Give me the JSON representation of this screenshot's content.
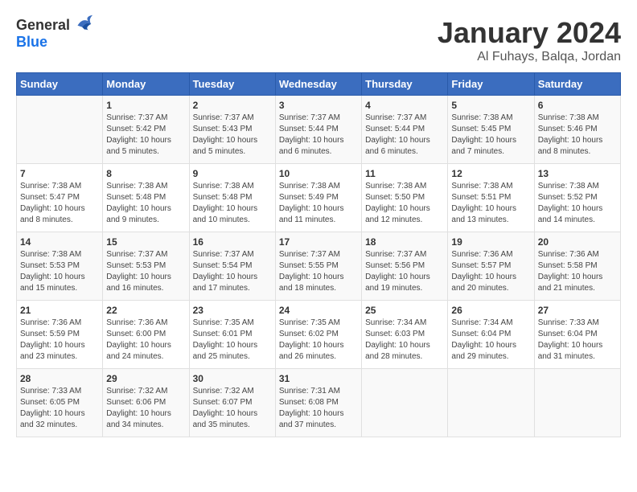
{
  "logo": {
    "general": "General",
    "blue": "Blue"
  },
  "title": "January 2024",
  "location": "Al Fuhays, Balqa, Jordan",
  "days_of_week": [
    "Sunday",
    "Monday",
    "Tuesday",
    "Wednesday",
    "Thursday",
    "Friday",
    "Saturday"
  ],
  "weeks": [
    [
      {
        "day": "",
        "sunrise": "",
        "sunset": "",
        "daylight": ""
      },
      {
        "day": "1",
        "sunrise": "Sunrise: 7:37 AM",
        "sunset": "Sunset: 5:42 PM",
        "daylight": "Daylight: 10 hours and 5 minutes."
      },
      {
        "day": "2",
        "sunrise": "Sunrise: 7:37 AM",
        "sunset": "Sunset: 5:43 PM",
        "daylight": "Daylight: 10 hours and 5 minutes."
      },
      {
        "day": "3",
        "sunrise": "Sunrise: 7:37 AM",
        "sunset": "Sunset: 5:44 PM",
        "daylight": "Daylight: 10 hours and 6 minutes."
      },
      {
        "day": "4",
        "sunrise": "Sunrise: 7:37 AM",
        "sunset": "Sunset: 5:44 PM",
        "daylight": "Daylight: 10 hours and 6 minutes."
      },
      {
        "day": "5",
        "sunrise": "Sunrise: 7:38 AM",
        "sunset": "Sunset: 5:45 PM",
        "daylight": "Daylight: 10 hours and 7 minutes."
      },
      {
        "day": "6",
        "sunrise": "Sunrise: 7:38 AM",
        "sunset": "Sunset: 5:46 PM",
        "daylight": "Daylight: 10 hours and 8 minutes."
      }
    ],
    [
      {
        "day": "7",
        "sunrise": "Sunrise: 7:38 AM",
        "sunset": "Sunset: 5:47 PM",
        "daylight": "Daylight: 10 hours and 8 minutes."
      },
      {
        "day": "8",
        "sunrise": "Sunrise: 7:38 AM",
        "sunset": "Sunset: 5:48 PM",
        "daylight": "Daylight: 10 hours and 9 minutes."
      },
      {
        "day": "9",
        "sunrise": "Sunrise: 7:38 AM",
        "sunset": "Sunset: 5:48 PM",
        "daylight": "Daylight: 10 hours and 10 minutes."
      },
      {
        "day": "10",
        "sunrise": "Sunrise: 7:38 AM",
        "sunset": "Sunset: 5:49 PM",
        "daylight": "Daylight: 10 hours and 11 minutes."
      },
      {
        "day": "11",
        "sunrise": "Sunrise: 7:38 AM",
        "sunset": "Sunset: 5:50 PM",
        "daylight": "Daylight: 10 hours and 12 minutes."
      },
      {
        "day": "12",
        "sunrise": "Sunrise: 7:38 AM",
        "sunset": "Sunset: 5:51 PM",
        "daylight": "Daylight: 10 hours and 13 minutes."
      },
      {
        "day": "13",
        "sunrise": "Sunrise: 7:38 AM",
        "sunset": "Sunset: 5:52 PM",
        "daylight": "Daylight: 10 hours and 14 minutes."
      }
    ],
    [
      {
        "day": "14",
        "sunrise": "Sunrise: 7:38 AM",
        "sunset": "Sunset: 5:53 PM",
        "daylight": "Daylight: 10 hours and 15 minutes."
      },
      {
        "day": "15",
        "sunrise": "Sunrise: 7:37 AM",
        "sunset": "Sunset: 5:53 PM",
        "daylight": "Daylight: 10 hours and 16 minutes."
      },
      {
        "day": "16",
        "sunrise": "Sunrise: 7:37 AM",
        "sunset": "Sunset: 5:54 PM",
        "daylight": "Daylight: 10 hours and 17 minutes."
      },
      {
        "day": "17",
        "sunrise": "Sunrise: 7:37 AM",
        "sunset": "Sunset: 5:55 PM",
        "daylight": "Daylight: 10 hours and 18 minutes."
      },
      {
        "day": "18",
        "sunrise": "Sunrise: 7:37 AM",
        "sunset": "Sunset: 5:56 PM",
        "daylight": "Daylight: 10 hours and 19 minutes."
      },
      {
        "day": "19",
        "sunrise": "Sunrise: 7:36 AM",
        "sunset": "Sunset: 5:57 PM",
        "daylight": "Daylight: 10 hours and 20 minutes."
      },
      {
        "day": "20",
        "sunrise": "Sunrise: 7:36 AM",
        "sunset": "Sunset: 5:58 PM",
        "daylight": "Daylight: 10 hours and 21 minutes."
      }
    ],
    [
      {
        "day": "21",
        "sunrise": "Sunrise: 7:36 AM",
        "sunset": "Sunset: 5:59 PM",
        "daylight": "Daylight: 10 hours and 23 minutes."
      },
      {
        "day": "22",
        "sunrise": "Sunrise: 7:36 AM",
        "sunset": "Sunset: 6:00 PM",
        "daylight": "Daylight: 10 hours and 24 minutes."
      },
      {
        "day": "23",
        "sunrise": "Sunrise: 7:35 AM",
        "sunset": "Sunset: 6:01 PM",
        "daylight": "Daylight: 10 hours and 25 minutes."
      },
      {
        "day": "24",
        "sunrise": "Sunrise: 7:35 AM",
        "sunset": "Sunset: 6:02 PM",
        "daylight": "Daylight: 10 hours and 26 minutes."
      },
      {
        "day": "25",
        "sunrise": "Sunrise: 7:34 AM",
        "sunset": "Sunset: 6:03 PM",
        "daylight": "Daylight: 10 hours and 28 minutes."
      },
      {
        "day": "26",
        "sunrise": "Sunrise: 7:34 AM",
        "sunset": "Sunset: 6:04 PM",
        "daylight": "Daylight: 10 hours and 29 minutes."
      },
      {
        "day": "27",
        "sunrise": "Sunrise: 7:33 AM",
        "sunset": "Sunset: 6:04 PM",
        "daylight": "Daylight: 10 hours and 31 minutes."
      }
    ],
    [
      {
        "day": "28",
        "sunrise": "Sunrise: 7:33 AM",
        "sunset": "Sunset: 6:05 PM",
        "daylight": "Daylight: 10 hours and 32 minutes."
      },
      {
        "day": "29",
        "sunrise": "Sunrise: 7:32 AM",
        "sunset": "Sunset: 6:06 PM",
        "daylight": "Daylight: 10 hours and 34 minutes."
      },
      {
        "day": "30",
        "sunrise": "Sunrise: 7:32 AM",
        "sunset": "Sunset: 6:07 PM",
        "daylight": "Daylight: 10 hours and 35 minutes."
      },
      {
        "day": "31",
        "sunrise": "Sunrise: 7:31 AM",
        "sunset": "Sunset: 6:08 PM",
        "daylight": "Daylight: 10 hours and 37 minutes."
      },
      {
        "day": "",
        "sunrise": "",
        "sunset": "",
        "daylight": ""
      },
      {
        "day": "",
        "sunrise": "",
        "sunset": "",
        "daylight": ""
      },
      {
        "day": "",
        "sunrise": "",
        "sunset": "",
        "daylight": ""
      }
    ]
  ]
}
